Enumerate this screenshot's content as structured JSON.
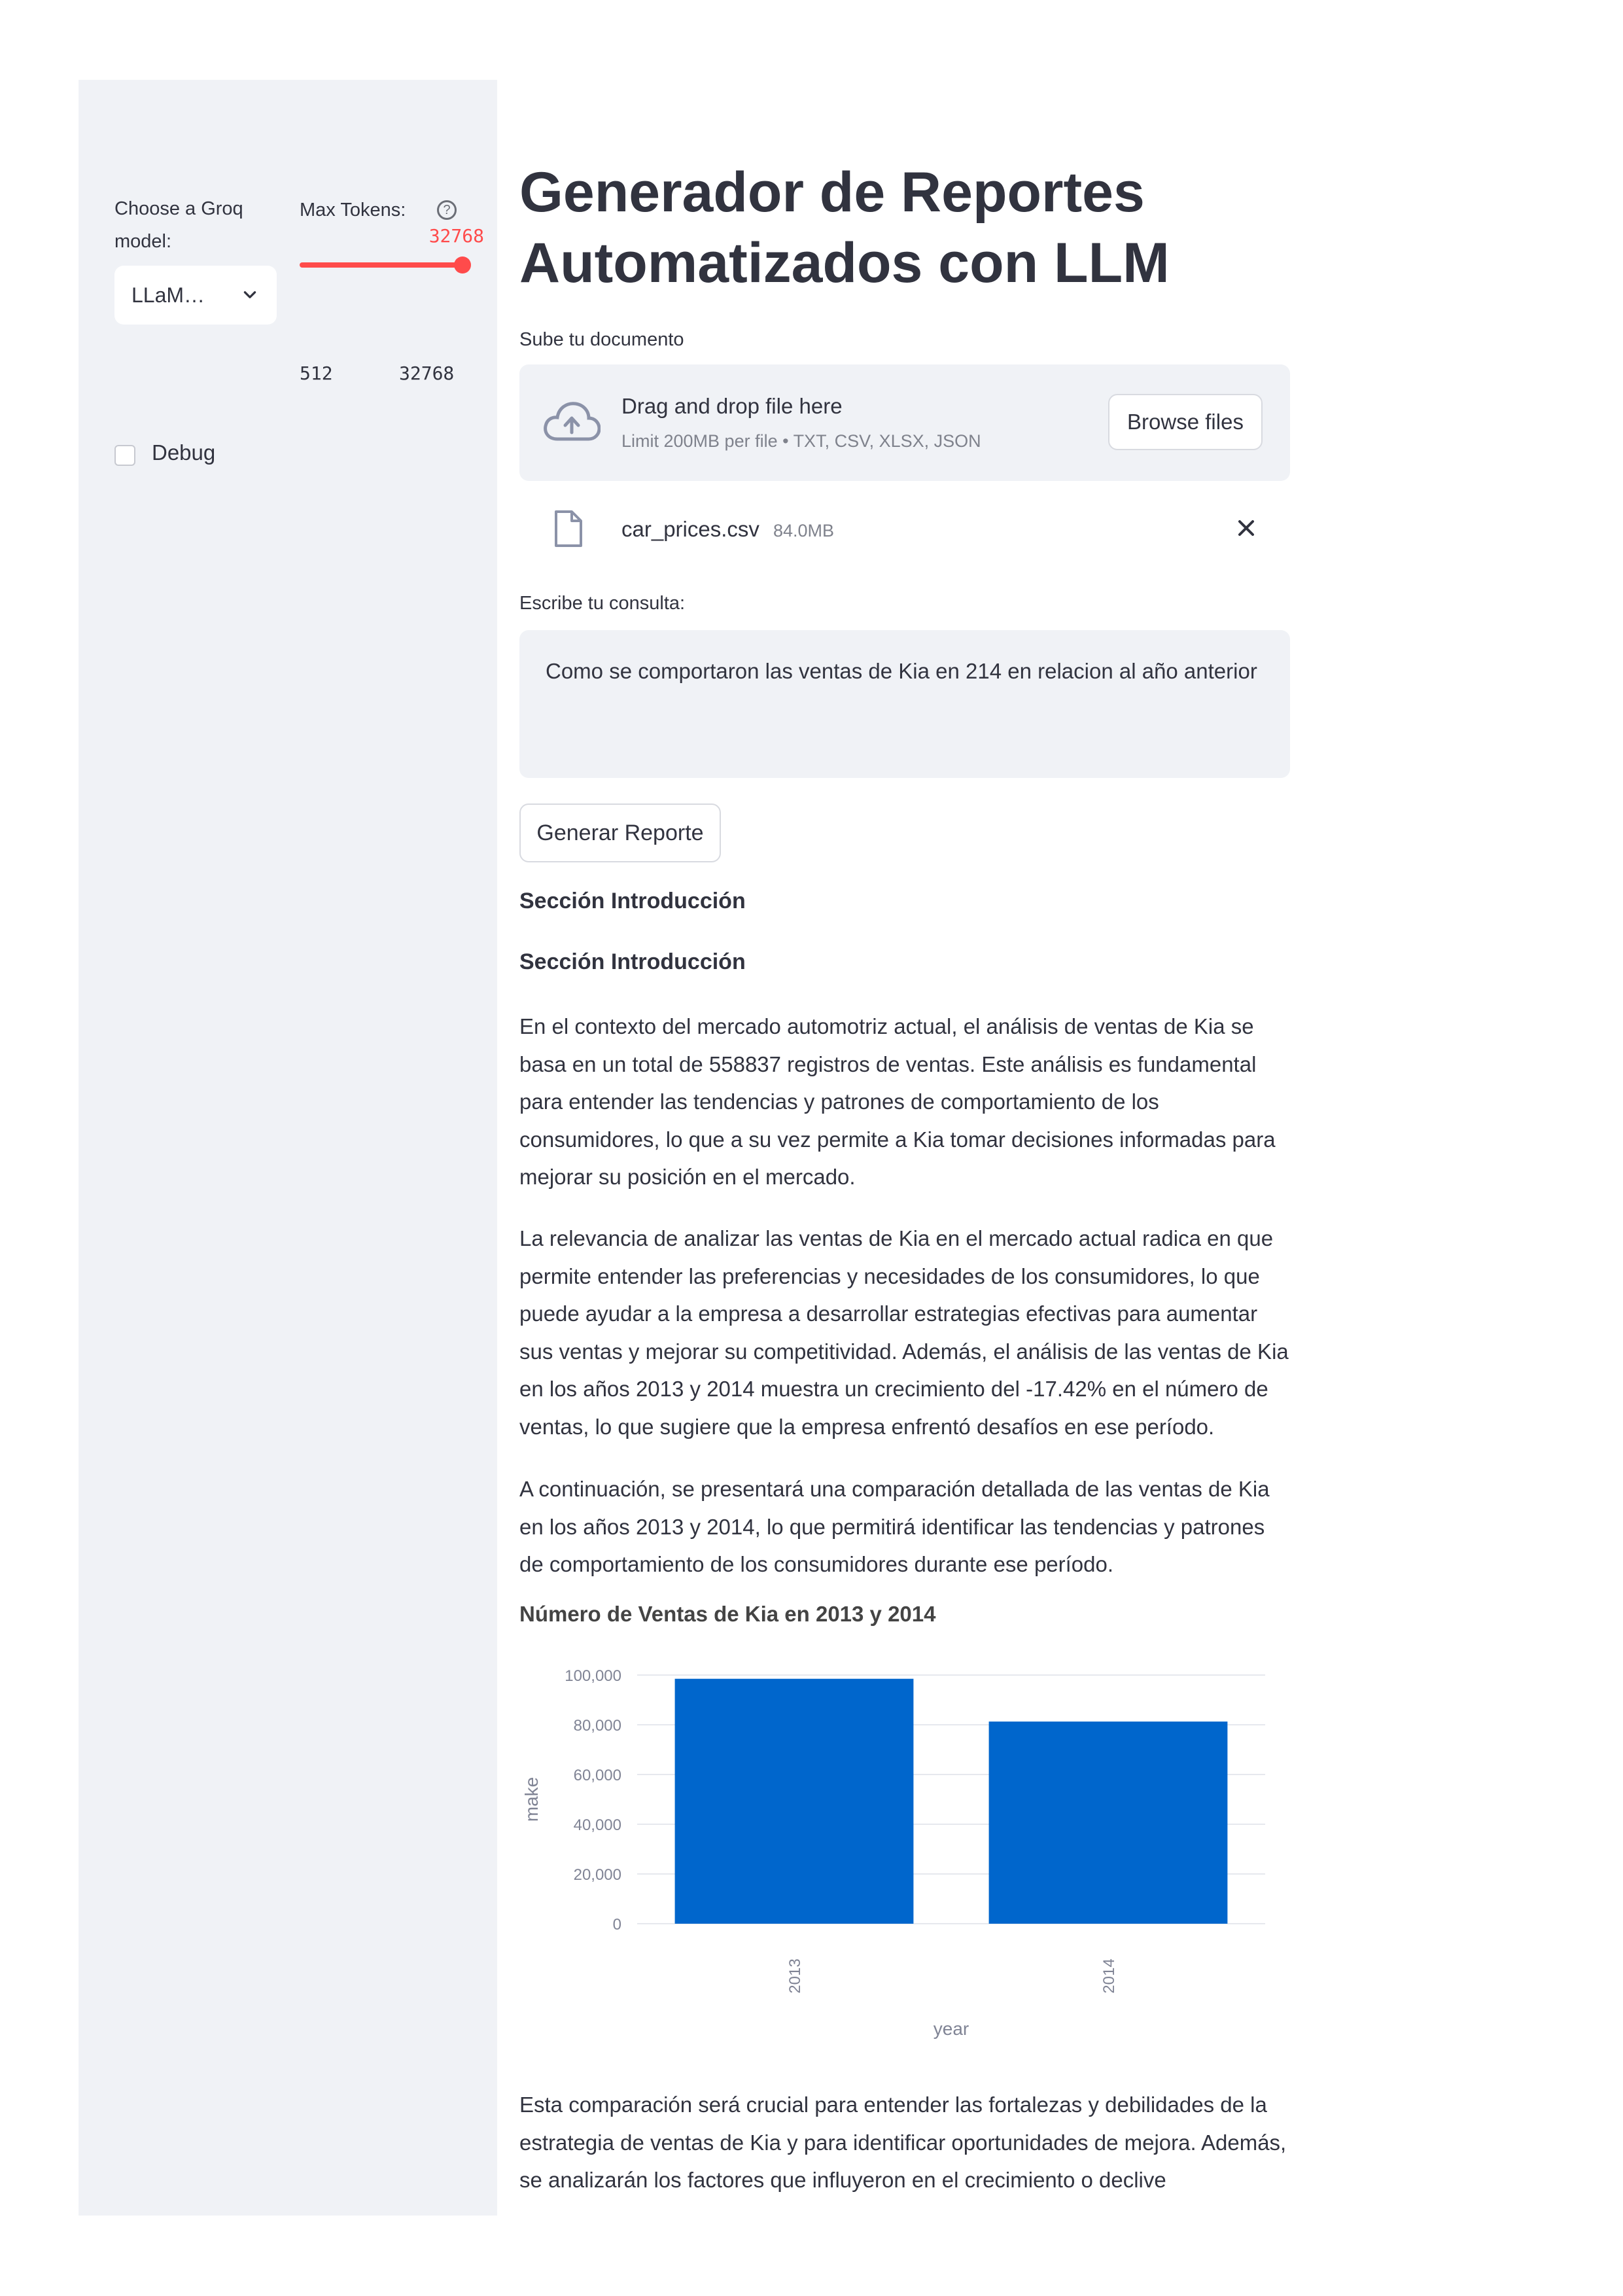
{
  "sidebar": {
    "model_label": "Choose a Groq model:",
    "model_label_line1": "Choose a Groq",
    "model_label_line2": "model:",
    "model_selected": "LLaM…",
    "tokens_label": "Max Tokens:",
    "tokens_value": "32768",
    "tokens_min": "512",
    "tokens_max": "32768",
    "tokens_fraction": 1.0,
    "debug_label": "Debug",
    "debug_checked": false
  },
  "main": {
    "title_line1": "Generador de Reportes",
    "title_line2": "Automatizados con LLM",
    "upload_label": "Sube tu documento",
    "dropzone_title": "Drag and drop file here",
    "dropzone_limit": "Limit 200MB per file • TXT, CSV, XLSX, JSON",
    "browse_button": "Browse files",
    "file_name": "car_prices.csv",
    "file_size": "84.0MB",
    "query_label": "Escribe tu consulta:",
    "query_value": "Como se comportaron las ventas de Kia en 214 en relacion al año anterior",
    "generate_button": "Generar Reporte"
  },
  "report": {
    "heading1": "Sección Introducción",
    "heading2": "Sección Introducción",
    "para1": "En el contexto del mercado automotriz actual, el análisis de ventas de Kia se basa en un total de 558837 registros de ventas. Este análisis es fundamental para entender las tendencias y patrones de comportamiento de los consumidores, lo que a su vez permite a Kia tomar decisiones informadas para mejorar su posición en el mercado.",
    "para2": "La relevancia de analizar las ventas de Kia en el mercado actual radica en que permite entender las preferencias y necesidades de los consumidores, lo que puede ayudar a la empresa a desarrollar estrategias efectivas para aumentar sus ventas y mejorar su competitividad. Además, el análisis de las ventas de Kia en los años 2013 y 2014 muestra un crecimiento del -17.42% en el número de ventas, lo que sugiere que la empresa enfrentó desafíos en ese período.",
    "para3": "A continuación, se presentará una comparación detallada de las ventas de Kia en los años 2013 y 2014, lo que permitirá identificar las tendencias y patrones de comportamiento de los consumidores durante ese período.",
    "para4": "Esta comparación será crucial para entender las fortalezas y debilidades de la estrategia de ventas de Kia y para identificar oportunidades de mejora. Además, se analizarán los factores que influyeron en el crecimiento o declive"
  },
  "chart_data": {
    "type": "bar",
    "title": "Número de Ventas de Kia en 2013 y 2014",
    "categories": [
      "2013",
      "2014"
    ],
    "values": [
      98500,
      81300
    ],
    "xlabel": "year",
    "ylabel": "make",
    "ylim": [
      0,
      100000
    ],
    "yticks": [
      0,
      20000,
      40000,
      60000,
      80000,
      100000
    ],
    "ytick_labels": [
      "0",
      "20,000",
      "40,000",
      "60,000",
      "80,000",
      "100,000"
    ],
    "bar_color": "#0066cc",
    "grid": true
  },
  "colors": {
    "accent": "#ff4b4b",
    "sidebar_bg": "#f0f2f6",
    "text": "#31333f"
  }
}
